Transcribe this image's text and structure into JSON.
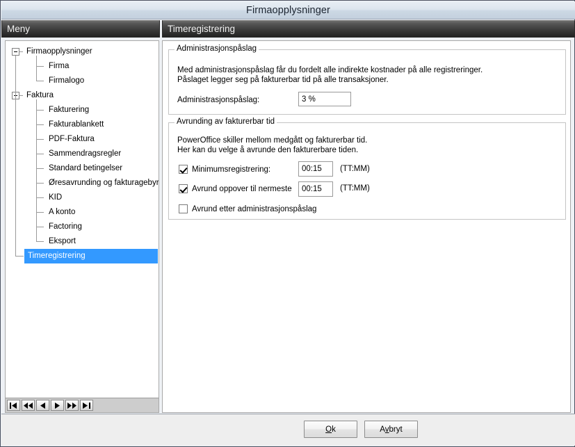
{
  "window": {
    "title": "Firmaopplysninger"
  },
  "headers": {
    "menu_label": "Meny",
    "page_label": "Timeregistrering"
  },
  "tree": {
    "items": [
      {
        "label": "Firmaopplysninger",
        "level": 0,
        "expander": "minus",
        "selected": false
      },
      {
        "label": "Firma",
        "level": 1,
        "expander": "none",
        "selected": false
      },
      {
        "label": "Firmalogo",
        "level": 1,
        "expander": "none",
        "selected": false
      },
      {
        "label": "Faktura",
        "level": 0,
        "expander": "minus",
        "selected": false
      },
      {
        "label": "Fakturering",
        "level": 1,
        "expander": "none",
        "selected": false
      },
      {
        "label": "Fakturablankett",
        "level": 1,
        "expander": "none",
        "selected": false
      },
      {
        "label": "PDF-Faktura",
        "level": 1,
        "expander": "none",
        "selected": false
      },
      {
        "label": "Sammendragsregler",
        "level": 1,
        "expander": "none",
        "selected": false
      },
      {
        "label": "Standard betingelser",
        "level": 1,
        "expander": "none",
        "selected": false
      },
      {
        "label": "Øresavrunding og fakturagebyr",
        "level": 1,
        "expander": "none",
        "selected": false
      },
      {
        "label": "KID",
        "level": 1,
        "expander": "none",
        "selected": false
      },
      {
        "label": "A konto",
        "level": 1,
        "expander": "none",
        "selected": false
      },
      {
        "label": "Factoring",
        "level": 1,
        "expander": "none",
        "selected": false
      },
      {
        "label": "Eksport",
        "level": 1,
        "expander": "none",
        "selected": false
      },
      {
        "label": "Timeregistrering",
        "level": 0,
        "expander": "none",
        "selected": true
      }
    ],
    "nav_buttons": [
      {
        "name": "first-record-button",
        "icon": "first-icon"
      },
      {
        "name": "fast-previous-record-button",
        "icon": "fast-previous-icon"
      },
      {
        "name": "previous-record-button",
        "icon": "previous-icon"
      },
      {
        "name": "next-record-button",
        "icon": "next-icon"
      },
      {
        "name": "fast-next-record-button",
        "icon": "fast-next-icon"
      },
      {
        "name": "last-record-button",
        "icon": "last-icon"
      }
    ]
  },
  "admin_group": {
    "legend": "Administrasjonspåslag",
    "description_line1": "Med administrasjonspåslag får du fordelt alle indirekte kostnader på alle registreringer.",
    "description_line2": "Påslaget legger seg på fakturerbar tid på alle transaksjoner.",
    "field_label": "Administrasjonspåslag:",
    "field_value": "3 %"
  },
  "rounding_group": {
    "legend": "Avrunding av fakturerbar tid",
    "description_line1": "PowerOffice skiller mellom medgått og fakturerbar tid.",
    "description_line2": "Her kan du velge å avrunde den fakturerbare tiden.",
    "row1": {
      "label": "Minimumsregistrering:",
      "checked": true,
      "value": "00:15",
      "unit": "(TT:MM)"
    },
    "row2": {
      "label": "Avrund oppover til nermeste",
      "checked": true,
      "value": "00:15",
      "unit": "(TT:MM)"
    },
    "row3": {
      "label": "Avrund etter administrasjonspåslag",
      "checked": false
    }
  },
  "footer": {
    "ok_prefix": "",
    "ok_accel": "O",
    "ok_suffix": "k",
    "cancel_prefix": "A",
    "cancel_accel": "v",
    "cancel_suffix": "bryt"
  },
  "colors": {
    "selection_blue": "#3399ff",
    "header_dark": "#3b3b3b",
    "titlebar_light": "#dce5ee",
    "panel_white": "#ffffff"
  }
}
